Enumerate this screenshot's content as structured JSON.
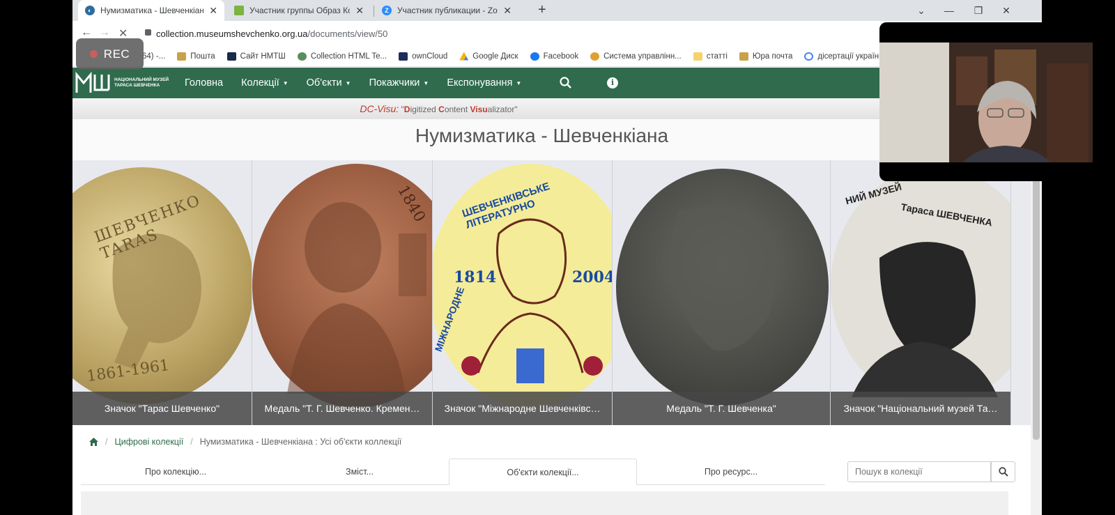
{
  "browser": {
    "tabs": [
      {
        "title": "Нумизматика - Шевченкіана / І",
        "active": true
      },
      {
        "title": "Участник группы Образ Кобзар",
        "active": false
      },
      {
        "title": "Участник публикации - Zoom",
        "active": false
      }
    ],
    "url_host": "collection.museumshevchenko.org.ua",
    "url_path": "/documents/view/50"
  },
  "bookmarks": [
    "64) -...",
    "Пошта",
    "Сайт НМТШ",
    "Collection HTML Te...",
    "ownCloud",
    "Google Диск",
    "Facebook",
    "Система управлінн...",
    "статті",
    "Юра почта",
    "дісертації україни..."
  ],
  "site": {
    "logo_line1": "НАЦІОНАЛЬНИЙ МУЗЕЙ",
    "logo_line2": "ТАРАСА ШЕВЧЕНКА",
    "menu": [
      "Головна",
      "Колекції",
      "Об'єкти",
      "Покажчики",
      "Експонування"
    ],
    "dcvisu_brand": "DC-Visu:",
    "dcvisu_q1": "\"",
    "dcvisu_d": "D",
    "dcvisu_igitized": "igitized ",
    "dcvisu_c": "C",
    "dcvisu_ontent": "ontent ",
    "dcvisu_visu": "Visu",
    "dcvisu_alizator": "alizator\"",
    "page_title": "Нумизматика - Шевченкіана"
  },
  "carousel": [
    {
      "caption": "Значок \"Тарас Шевченко\"",
      "coin_text": "ШЕВЧЕНКО TARAS",
      "years": "1861-1961"
    },
    {
      "caption": "Медаль \"Т. Г. Шевченко. Кремен…",
      "coin_text": "1840"
    },
    {
      "caption": "Значок \"Міжнародне Шевченківс…",
      "coin_text": "ШЕВЧЕНКІВСЬКЕ ЛІТЕРАТУРНО",
      "year_left": "1814",
      "year_right": "2004",
      "coin_text_bottom": "МІЖНАРОДНЕ"
    },
    {
      "caption": "Медаль \"Т. Г. Шевченка\""
    },
    {
      "caption": "Значок \"Національний музей Та…",
      "coin_text": "НИЙ МУЗЕЙ",
      "coin_text2": "Тараса ШЕВЧЕНКА"
    }
  ],
  "breadcrumb": {
    "link": "Цифрові колекції",
    "current": "Нумизматика - Шевченкіана : Усі об'єкти коллекції"
  },
  "content_tabs": [
    "Про колекцію...",
    "Зміст...",
    "Об'єкти колекції...",
    "Про ресурс..."
  ],
  "search_placeholder": "Пошук в колекції",
  "rec_label": "REC",
  "colors": {
    "nav_green": "#2f6b4c",
    "dc_red": "#c0392b"
  }
}
